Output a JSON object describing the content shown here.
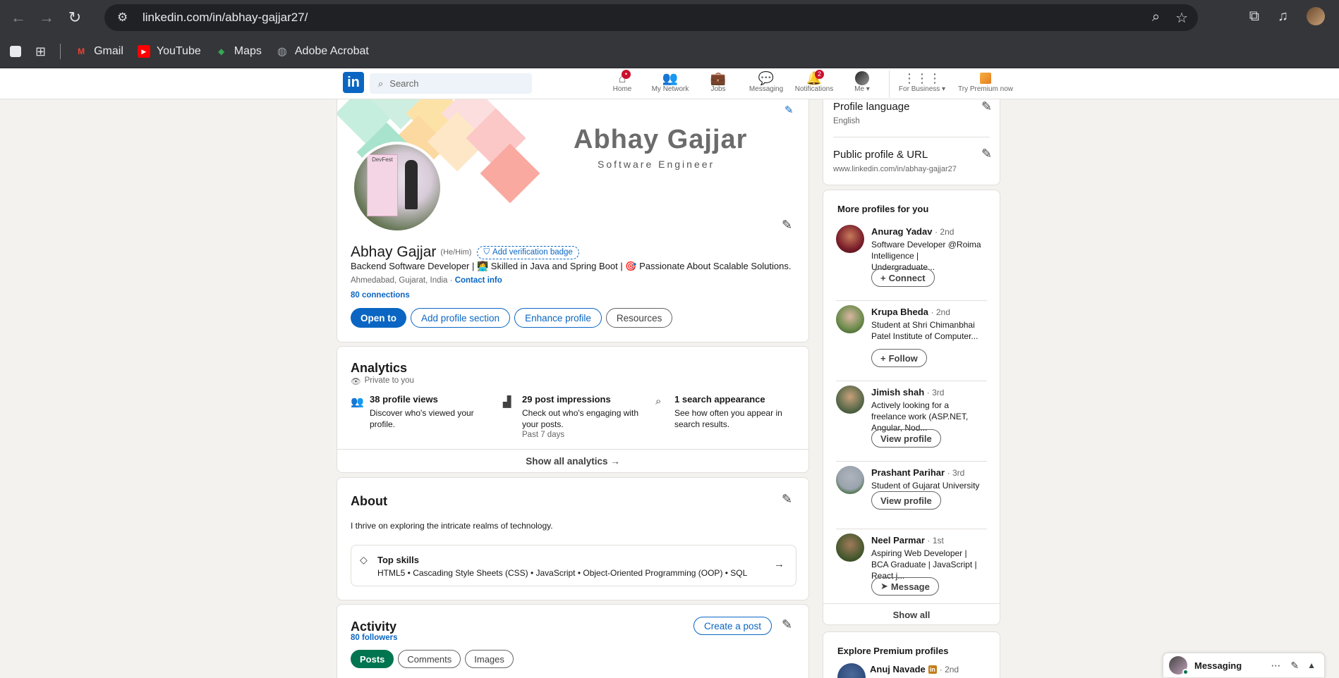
{
  "browser": {
    "url": "linkedin.com/in/abhay-gajjar27/",
    "bookmarks": [
      {
        "label": "Gmail",
        "icon": "gmail-icon",
        "color": "#ea4335"
      },
      {
        "label": "YouTube",
        "icon": "youtube-icon",
        "color": "#ff0000"
      },
      {
        "label": "Maps",
        "icon": "maps-icon",
        "color": "#34a853"
      },
      {
        "label": "Adobe Acrobat",
        "icon": "globe-icon",
        "color": "#9aa0a6"
      }
    ]
  },
  "nav": {
    "search_placeholder": "Search",
    "items": [
      {
        "label": "Home",
        "icon": "home-icon",
        "badge": "•"
      },
      {
        "label": "My Network",
        "icon": "network-icon",
        "badge": ""
      },
      {
        "label": "Jobs",
        "icon": "jobs-icon",
        "badge": ""
      },
      {
        "label": "Messaging",
        "icon": "messaging-icon",
        "badge": ""
      },
      {
        "label": "Notifications",
        "icon": "bell-icon",
        "badge": "2"
      },
      {
        "label": "Me ▾",
        "icon": "me-avatar",
        "badge": ""
      }
    ],
    "for_business": "For Business ▾",
    "premium": "Try Premium now"
  },
  "profile": {
    "banner_name": "Abhay Gajjar",
    "banner_title": "Software Engineer",
    "name": "Abhay Gajjar",
    "pronouns": "(He/Him)",
    "verification": "Add verification badge",
    "headline": "Backend Software Developer | 👩‍💻 Skilled in Java and Spring Boot | 🎯 Passionate About Scalable Solutions.",
    "location": "Ahmedabad, Gujarat, India ·",
    "contact_info": "Contact info",
    "connections": "80 connections",
    "buttons": {
      "open_to": "Open to",
      "add_section": "Add profile section",
      "enhance": "Enhance profile",
      "resources": "Resources"
    },
    "dev_board_text": "DevFest"
  },
  "analytics": {
    "title": "Analytics",
    "private": "Private to you",
    "stats": [
      {
        "title": "38 profile views",
        "desc": "Discover who's viewed your profile.",
        "extra": ""
      },
      {
        "title": "29 post impressions",
        "desc": "Check out who's engaging with your posts.",
        "extra": "Past 7 days"
      },
      {
        "title": "1 search appearance",
        "desc": "See how often you appear in search results.",
        "extra": ""
      }
    ],
    "show_all": "Show all analytics →"
  },
  "about": {
    "title": "About",
    "text": "I thrive on exploring the intricate realms of technology.",
    "top_skills_title": "Top skills",
    "top_skills": "HTML5 • Cascading Style Sheets (CSS) • JavaScript • Object-Oriented Programming (OOP) • SQL"
  },
  "activity": {
    "title": "Activity",
    "followers": "80 followers",
    "create_post": "Create a post",
    "tabs": [
      "Posts",
      "Comments",
      "Images"
    ]
  },
  "sidebar": {
    "profile_language_title": "Profile language",
    "profile_language": "English",
    "public_profile_title": "Public profile & URL",
    "public_profile_url": "www.linkedin.com/in/abhay-gajjar27",
    "more_profiles_title": "More profiles for you",
    "profiles": [
      {
        "name": "Anurag Yadav",
        "degree": "· 2nd",
        "desc": "Software Developer @Roima Intelligence | Undergraduate...",
        "action": "Connect",
        "action_icon": "+"
      },
      {
        "name": "Krupa Bheda",
        "degree": "· 2nd",
        "desc": "Student at Shri Chimanbhai Patel Institute of Computer...",
        "action": "Follow",
        "action_icon": "+"
      },
      {
        "name": "Jimish shah",
        "degree": "· 3rd",
        "desc": "Actively looking for a freelance work (ASP.NET, Angular, Nod...",
        "action": "View profile",
        "action_icon": ""
      },
      {
        "name": "Prashant Parihar",
        "degree": "· 3rd",
        "desc": "Student of Gujarat University",
        "action": "View profile",
        "action_icon": ""
      },
      {
        "name": "Neel Parmar",
        "degree": "· 1st",
        "desc": "Aspiring Web Developer | BCA Graduate | JavaScript | React j...",
        "action": "Message",
        "action_icon": "➤"
      }
    ],
    "show_all": "Show all",
    "explore_title": "Explore Premium profiles",
    "explore_name": "Anuj Navade",
    "explore_degree": "· 2nd"
  },
  "messaging": {
    "label": "Messaging"
  }
}
